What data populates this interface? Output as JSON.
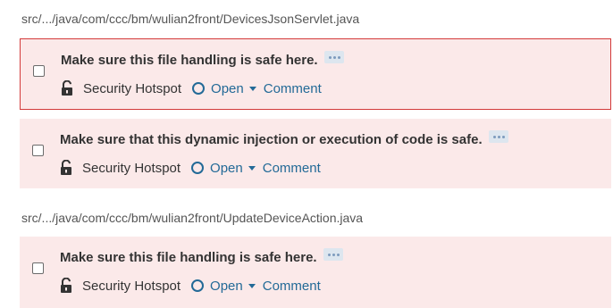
{
  "groups": [
    {
      "file_path": "src/.../java/com/ccc/bm/wulian2front/DevicesJsonServlet.java",
      "issues": [
        {
          "title": "Make sure this file handling is safe here.",
          "type": "Security Hotspot",
          "status": "Open",
          "comment": "Comment",
          "selected": true
        },
        {
          "title": "Make sure that this dynamic injection or execution of code is safe.",
          "type": "Security Hotspot",
          "status": "Open",
          "comment": "Comment",
          "selected": false
        }
      ]
    },
    {
      "file_path": "src/.../java/com/ccc/bm/wulian2front/UpdateDeviceAction.java",
      "issues": [
        {
          "title": "Make sure this file handling is safe here.",
          "type": "Security Hotspot",
          "status": "Open",
          "comment": "Comment",
          "selected": false
        }
      ]
    }
  ],
  "icons": {
    "lock": "unlocked-lock-icon",
    "status": "open-circle-icon",
    "caret": "chevron-down-icon",
    "more": "ellipsis-icon"
  },
  "colors": {
    "issue_background": "#fbe9e9",
    "selected_border": "#d33a3a",
    "link": "#236a97",
    "more_button_bg": "#dde6ef"
  }
}
